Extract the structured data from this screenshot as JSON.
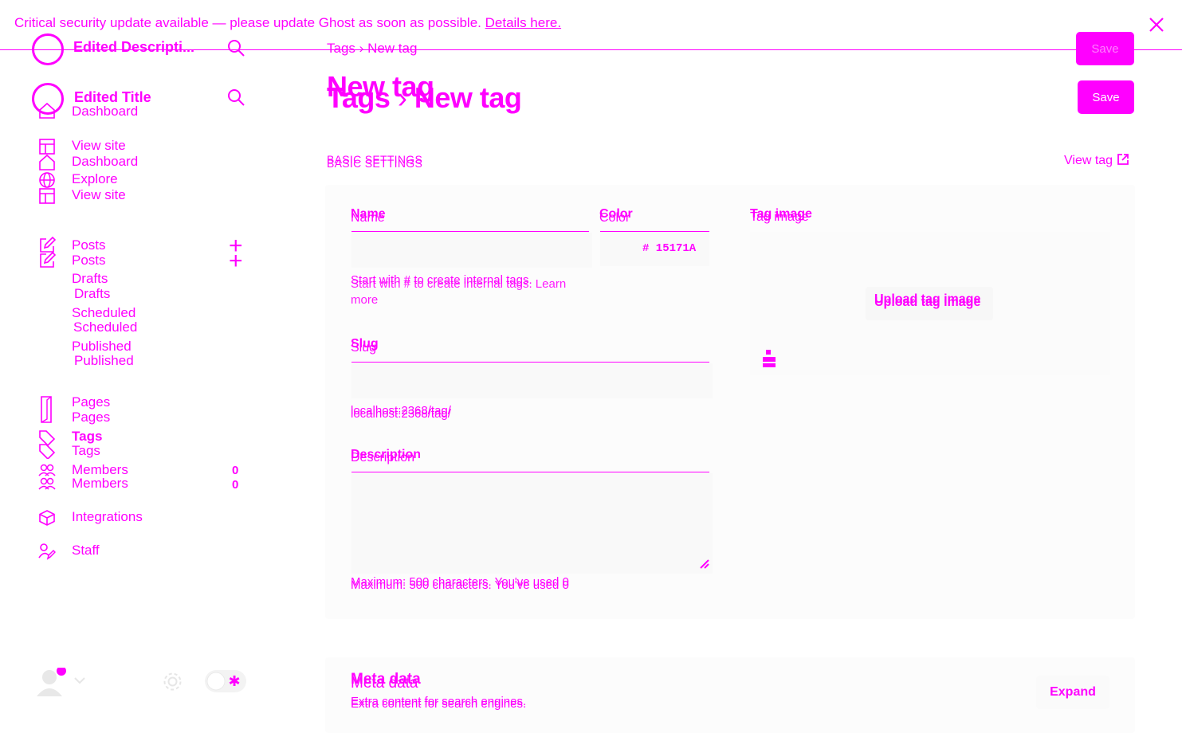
{
  "banner": {
    "message": "Critical security update available — please update Ghost as soon as possible.",
    "link": "Details here."
  },
  "sidebar": {
    "site_description": "Edited Descripti...",
    "site_title": "Edited Title",
    "items": {
      "dashboard": "Dashboard",
      "view_site": "View site",
      "explore": "Explore",
      "posts": "Posts",
      "drafts": "Drafts",
      "scheduled": "Scheduled",
      "published": "Published",
      "pages": "Pages",
      "tags": "Tags",
      "members": "Members",
      "members_count": "0",
      "integrations": "Integrations",
      "staff": "Staff"
    }
  },
  "header": {
    "breadcrumb_parent": "Tags",
    "breadcrumb_sep": "›",
    "breadcrumb_current": "New tag",
    "title": "New tag",
    "save_label": "Save"
  },
  "basic_settings": {
    "section_title": "BASIC SETTINGS",
    "view_tag": "View tag",
    "name_label": "Name",
    "name_value": "",
    "color_label": "Color",
    "color_value": "# 15171A",
    "name_hint": "Start with # to create internal tags.",
    "learn_more": "Learn more",
    "slug_label": "Slug",
    "slug_value": "",
    "slug_url": "localhost:2368/tag/",
    "description_label": "Description",
    "description_value": "",
    "description_hint": "Maximum: 500 characters. You've used 0",
    "tag_image_label": "Tag image",
    "upload_label": "Upload tag image"
  },
  "meta_data": {
    "title": "Meta data",
    "subtitle": "Extra content for search engines.",
    "expand": "Expand"
  },
  "colors": {
    "accent": "#ff00ff",
    "button_text": "#ffffff",
    "card": "#fcfcfc"
  }
}
